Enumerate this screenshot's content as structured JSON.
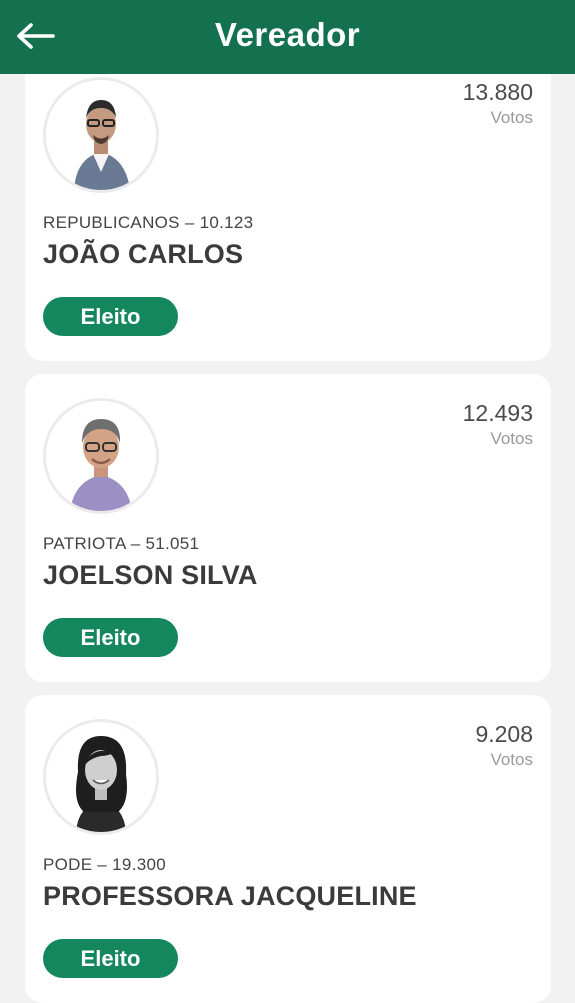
{
  "header": {
    "title": "Vereador",
    "back_icon": "arrow-left-icon",
    "background": "#137150"
  },
  "candidates": [
    {
      "party_line": "REPUBLICANOS – 10.123",
      "name": "JOÃO CARLOS",
      "votes": "13.880",
      "votes_label": "Votos",
      "status": "Eleito"
    },
    {
      "party_line": "PATRIOTA – 51.051",
      "name": "JOELSON SILVA",
      "votes": "12.493",
      "votes_label": "Votos",
      "status": "Eleito"
    },
    {
      "party_line": "PODE – 19.300",
      "name": "PROFESSORA JACQUELINE",
      "votes": "9.208",
      "votes_label": "Votos",
      "status": "Eleito"
    }
  ],
  "colors": {
    "accent": "#137150",
    "badge": "#15875e",
    "background": "#f2f2f2"
  }
}
